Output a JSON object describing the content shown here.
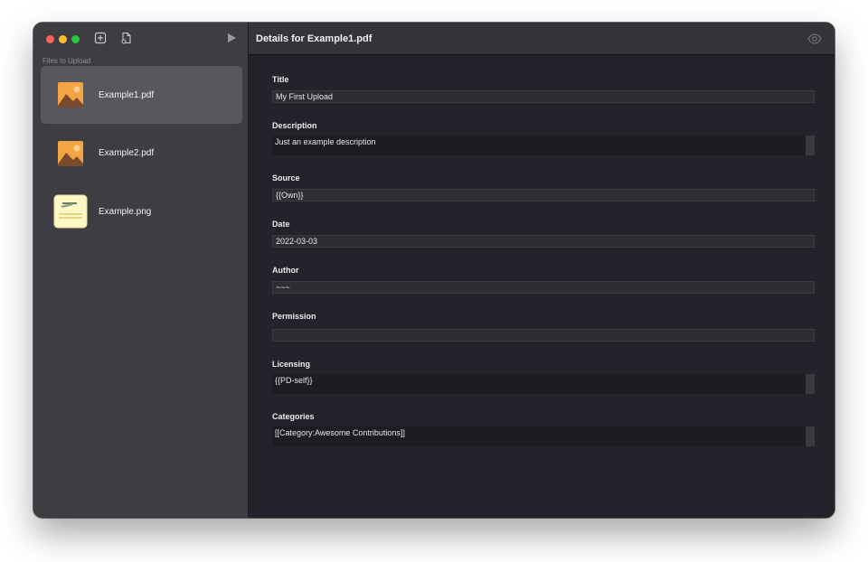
{
  "sidebar": {
    "section_label": "Files to Upload",
    "files": [
      {
        "name": "Example1.pdf",
        "icon": "image-placeholder-icon",
        "selected": true
      },
      {
        "name": "Example2.pdf",
        "icon": "image-placeholder-icon",
        "selected": false
      },
      {
        "name": "Example.png",
        "icon": "sticky-note-thumbnail",
        "selected": false
      }
    ]
  },
  "header": {
    "title": "Details for Example1.pdf"
  },
  "form": {
    "title_label": "Title",
    "title_value": "My First Upload",
    "description_label": "Description",
    "description_value": "Just an example description",
    "source_label": "Source",
    "source_value": "{{Own}}",
    "date_label": "Date",
    "date_value": "2022-03-03",
    "author_label": "Author",
    "author_value": "~~~",
    "permission_label": "Permission",
    "permission_value": "",
    "licensing_label": "Licensing",
    "licensing_value": "{{PD-self}}",
    "categories_label": "Categories",
    "categories_value": "[[Category:Awesome Contributions]]"
  },
  "colors": {
    "sidebar_bg": "#3e3d41",
    "selected_bg": "#58575c",
    "main_bg": "#24222a",
    "thumb_orange": "#f4a442"
  }
}
